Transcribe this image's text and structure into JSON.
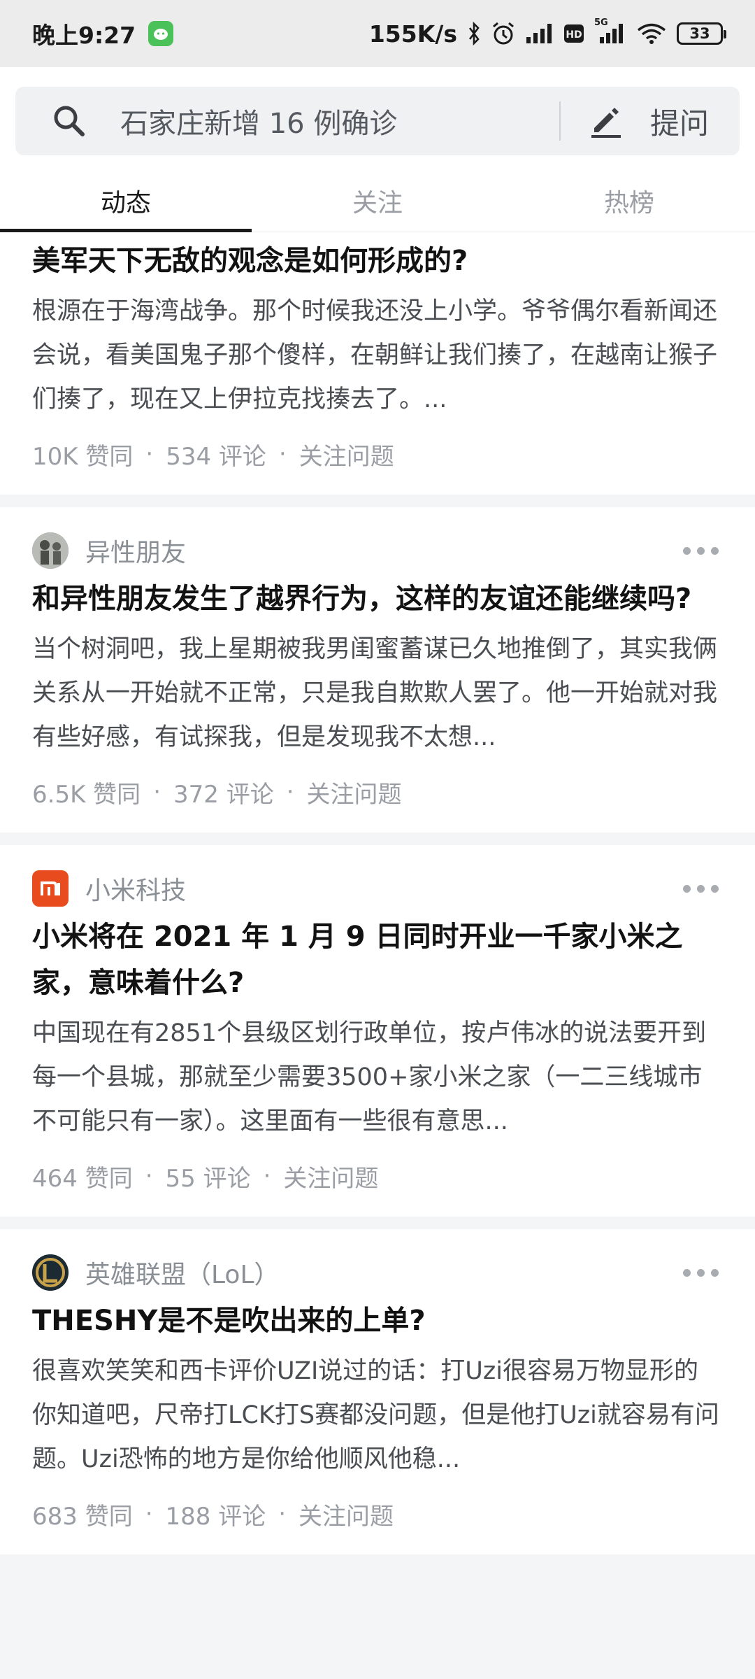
{
  "status_bar": {
    "time": "晚上9:27",
    "network_speed": "155K/s",
    "network_type": "5G",
    "battery": "33",
    "icons": [
      "wechat-icon",
      "bluetooth-icon",
      "alarm-icon",
      "signal-icon",
      "hd-icon",
      "wifi-icon",
      "battery-icon"
    ]
  },
  "search": {
    "placeholder": "石家庄新增 16 例确诊",
    "ask_label": "提问"
  },
  "tabs": [
    {
      "label": "动态",
      "active": true
    },
    {
      "label": "关注",
      "active": false
    },
    {
      "label": "热榜",
      "active": false
    }
  ],
  "feed": [
    {
      "author": "",
      "title": "美军天下无敌的观念是如何形成的?",
      "excerpt": "根源在于海湾战争。那个时候我还没上小学。爷爷偶尔看新闻还会说，看美国鬼子那个傻样，在朝鲜让我们揍了，在越南让猴子们揍了，现在又上伊拉克找揍去了。...",
      "likes": "10K 赞同",
      "comments": "534 评论",
      "follow": "关注问题"
    },
    {
      "author": "异性朋友",
      "title": "和异性朋友发生了越界行为，这样的友谊还能继续吗?",
      "excerpt": "当个树洞吧，我上星期被我男闺蜜蓄谋已久地推倒了，其实我俩关系从一开始就不正常，只是我自欺欺人罢了。他一开始就对我有些好感，有试探我，但是发现我不太想...",
      "likes": "6.5K 赞同",
      "comments": "372 评论",
      "follow": "关注问题"
    },
    {
      "author": "小米科技",
      "title": "小米将在 2021 年 1 月 9 日同时开业一千家小米之家，意味着什么?",
      "excerpt": "中国现在有2851个县级区划行政单位，按卢伟冰的说法要开到每一个县城，那就至少需要3500+家小米之家（一二三线城市不可能只有一家）。这里面有一些很有意思...",
      "likes": "464 赞同",
      "comments": "55 评论",
      "follow": "关注问题"
    },
    {
      "author": "英雄联盟（LoL）",
      "title": "THESHY是不是吹出来的上单?",
      "excerpt": "很喜欢笑笑和西卡评价UZI说过的话：打Uzi很容易万物显形的你知道吧，尺帝打LCK打S赛都没问题，但是他打Uzi就容易有问题。Uzi恐怖的地方是你给他顺风他稳...",
      "likes": "683 赞同",
      "comments": "188 评论",
      "follow": "关注问题"
    }
  ],
  "separator": "·"
}
